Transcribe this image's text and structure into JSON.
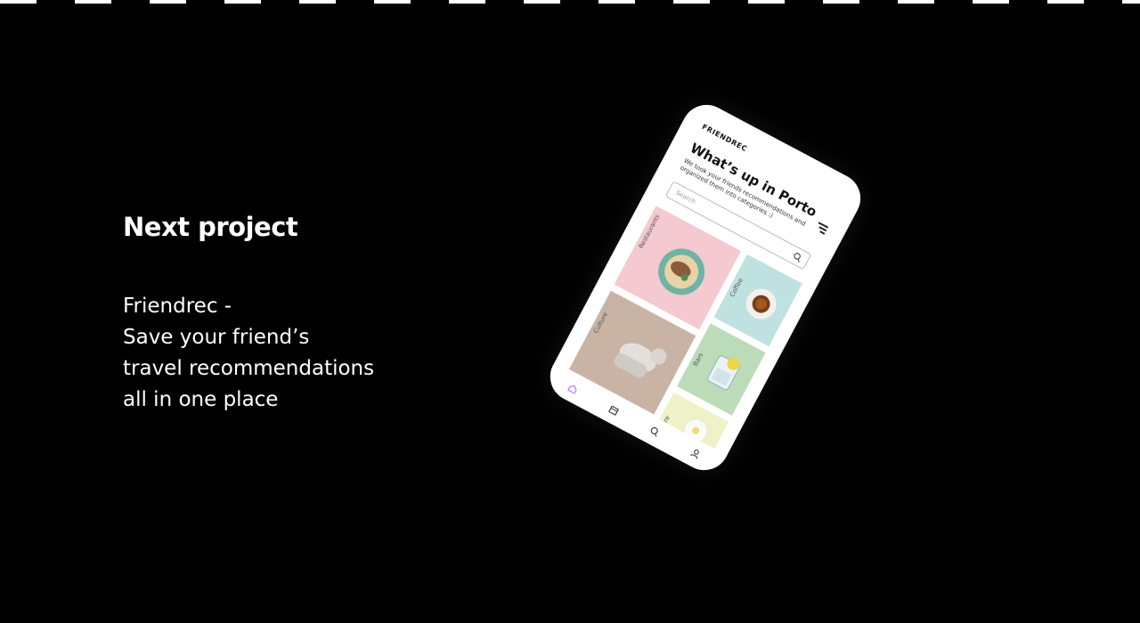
{
  "section": {
    "title": "Next project",
    "description_lines": [
      "Friendrec -",
      "Save your friend’s",
      "travel recommendations",
      "all in one place"
    ]
  },
  "phone": {
    "brand": "FRIENDREC",
    "heading": "What’s up in Porto",
    "subtext": "We took your friends recommendations and organized them into categories :)",
    "search_placeholder": "Search",
    "categories": [
      "Restaurants",
      "Coffee",
      "Culture",
      "Bars",
      "Nature"
    ],
    "nav_icons": [
      "home-icon",
      "calendar-icon",
      "search-icon",
      "profile-icon"
    ],
    "accent_color": "#c77dff"
  }
}
